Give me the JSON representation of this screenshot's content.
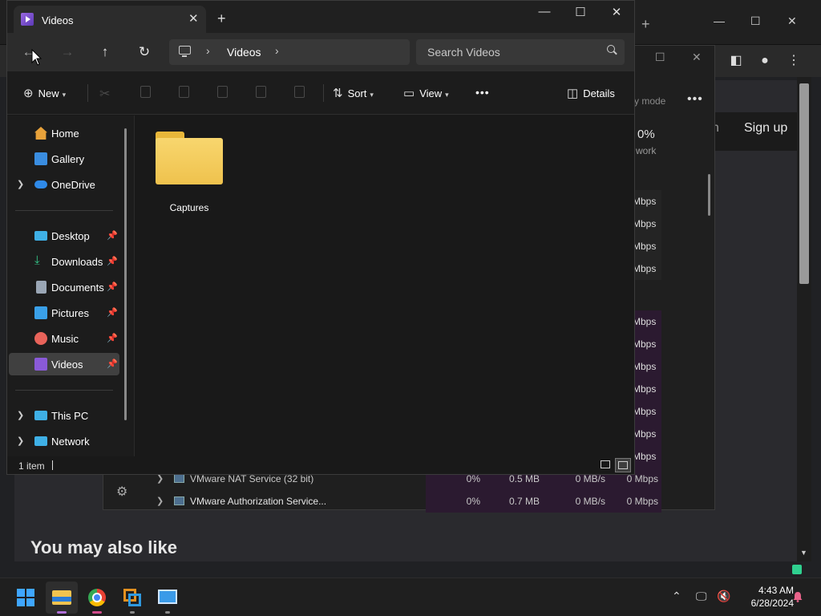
{
  "browser": {
    "new_tab": "+",
    "page_signin_fragment": "n",
    "page_signup": "Sign up",
    "page_heading": "You may also like"
  },
  "taskmgr": {
    "mode_fragment": "y mode",
    "more": "•••",
    "network_pct": "0%",
    "network_label": "work",
    "mbps_fragment": "Mbps",
    "rows": [
      {
        "name": "VMware NAT Service (32 bit)",
        "cpu": "0%",
        "mem": "0.5 MB",
        "disk": "0 MB/s",
        "net": "0 Mbps"
      },
      {
        "name": "VMware Authorization Service...",
        "cpu": "0%",
        "mem": "0.7 MB",
        "disk": "0 MB/s",
        "net": "0 Mbps"
      }
    ]
  },
  "explorer": {
    "tab_title": "Videos",
    "new_tab": "+",
    "address": {
      "crumb": "Videos"
    },
    "search": {
      "placeholder": "Search Videos"
    },
    "cmdbar": {
      "new_label": "New",
      "sort_label": "Sort",
      "view_label": "View",
      "more_label": "•••",
      "details_label": "Details"
    },
    "sidebar": {
      "items": [
        {
          "label": "Home",
          "icon": "home-icon",
          "color": "#e8a23a"
        },
        {
          "label": "Gallery",
          "icon": "gallery-icon",
          "color": "#3a8de0"
        },
        {
          "label": "OneDrive",
          "icon": "onedrive-icon",
          "color": "#2f8ae8"
        },
        {
          "label": "Desktop",
          "icon": "desktop-icon",
          "color": "#3fb0e6"
        },
        {
          "label": "Downloads",
          "icon": "download-icon",
          "color": "#34c88a"
        },
        {
          "label": "Documents",
          "icon": "documents-icon",
          "color": "#9aa6b5"
        },
        {
          "label": "Pictures",
          "icon": "pictures-icon",
          "color": "#3aa0e8"
        },
        {
          "label": "Music",
          "icon": "music-icon",
          "color": "#e8635a"
        },
        {
          "label": "Videos",
          "icon": "videos-icon",
          "color": "#8a5ad8"
        },
        {
          "label": "This PC",
          "icon": "this-pc-icon",
          "color": "#3fb0e6"
        },
        {
          "label": "Network",
          "icon": "network-icon",
          "color": "#3fb0e6"
        }
      ]
    },
    "folders": [
      {
        "name": "Captures"
      }
    ],
    "status": {
      "count": "1 item"
    }
  },
  "taskbar": {
    "time": "4:43 AM",
    "date": "6/28/2024"
  }
}
